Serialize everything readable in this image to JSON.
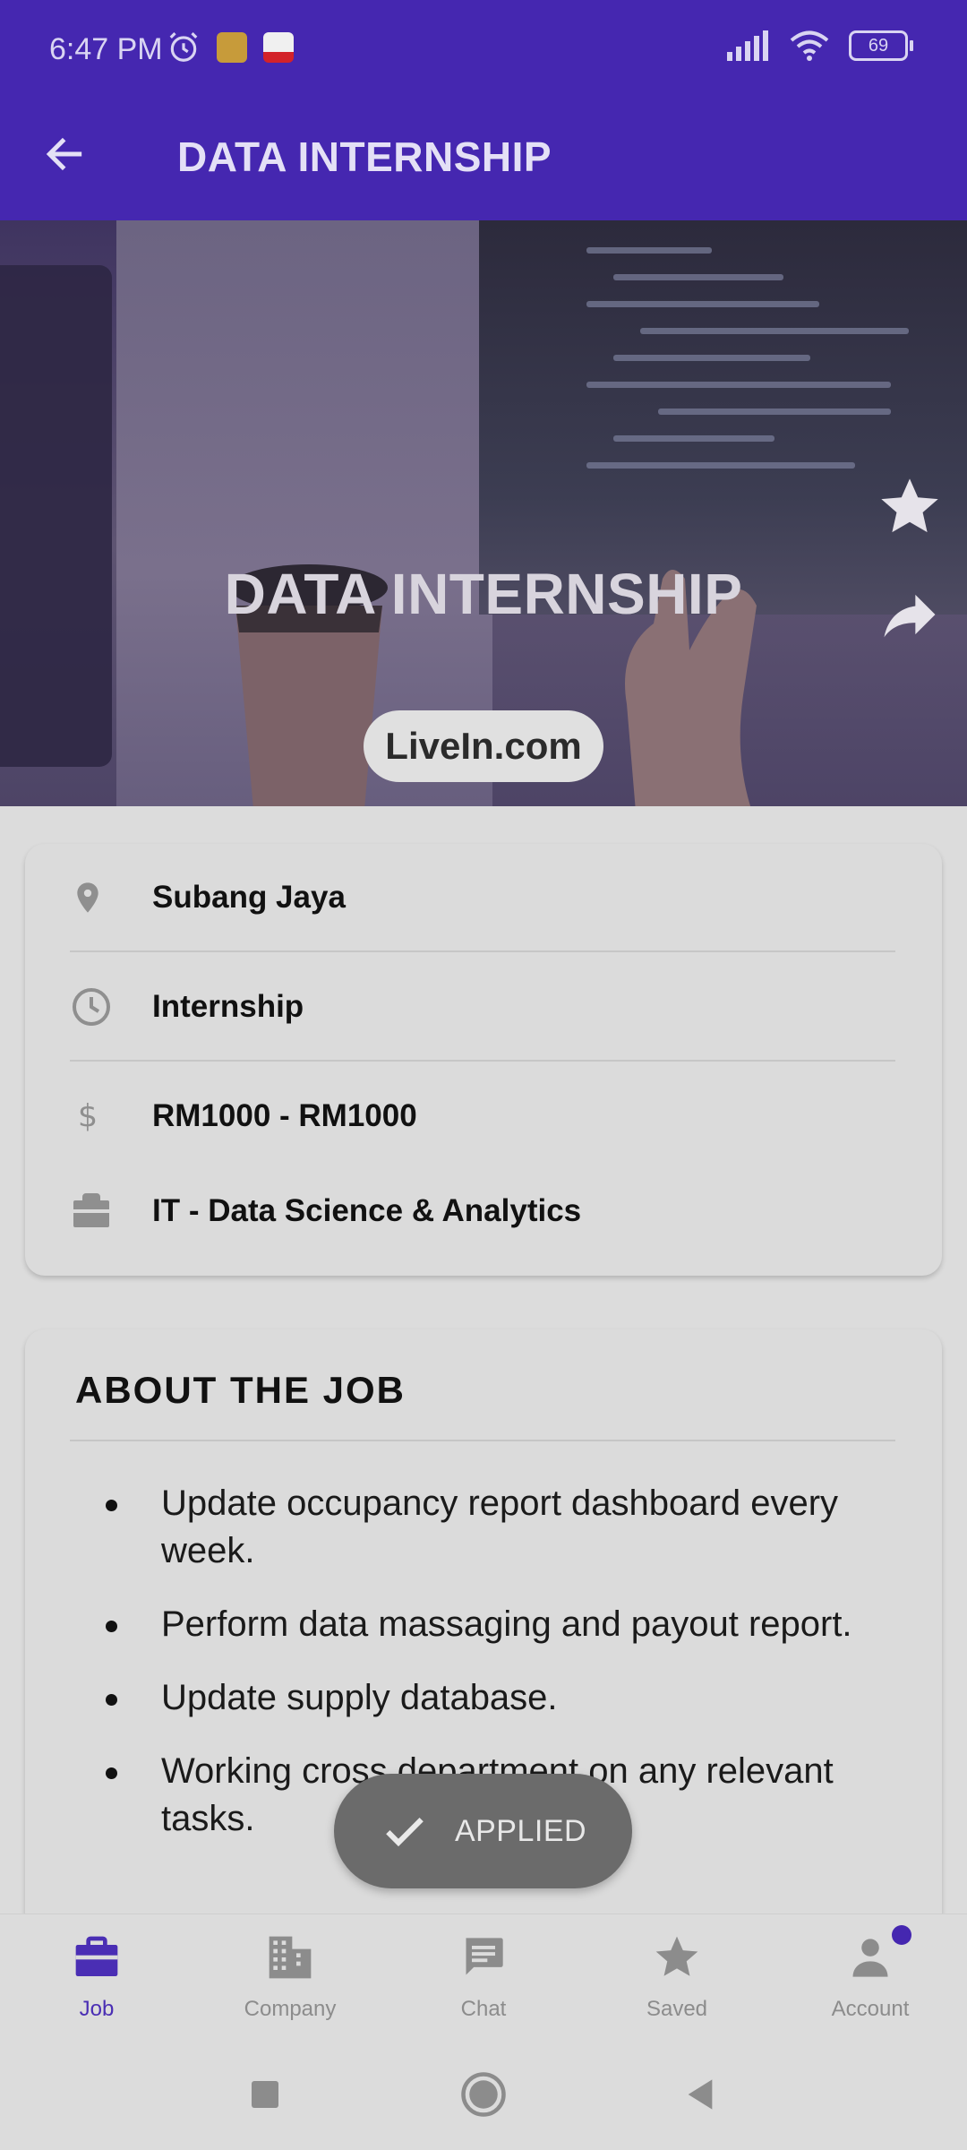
{
  "status_bar": {
    "time": "6:47 PM",
    "battery": "69",
    "icons": [
      "alarm-icon",
      "notification-app-icon",
      "news-app-icon",
      "signal-icon",
      "wifi-icon",
      "battery-icon"
    ]
  },
  "app_bar": {
    "back_icon": "arrow-left-icon",
    "title": "DATA INTERNSHIP"
  },
  "hero": {
    "title": "DATA INTERNSHIP",
    "company": "LiveIn.com",
    "favorite_icon": "star-icon",
    "share_icon": "share-icon"
  },
  "job_info": {
    "location": "Subang Jaya",
    "job_type": "Internship",
    "salary": "RM1000 - RM1000",
    "category": "IT - Data Science & Analytics"
  },
  "about": {
    "title": "ABOUT THE JOB",
    "items": [
      "Update occupancy report dashboard every week.",
      "Perform data massaging and payout report.",
      "Update supply database.",
      "Working cross department on any relevant tasks."
    ]
  },
  "toast": {
    "label": "APPLIED",
    "icon": "check-icon"
  },
  "bottom_nav": {
    "items": [
      {
        "label": "Job",
        "icon": "briefcase-icon",
        "active": true
      },
      {
        "label": "Company",
        "icon": "building-icon",
        "active": false
      },
      {
        "label": "Chat",
        "icon": "chat-icon",
        "active": false
      },
      {
        "label": "Saved",
        "icon": "star-icon",
        "active": false
      },
      {
        "label": "Account",
        "icon": "person-icon",
        "active": false
      }
    ]
  },
  "colors": {
    "primary": "#4527b0",
    "background": "#dcdcdc",
    "toast": "#6b6b6b",
    "nav_inactive": "#8c8c8c"
  }
}
